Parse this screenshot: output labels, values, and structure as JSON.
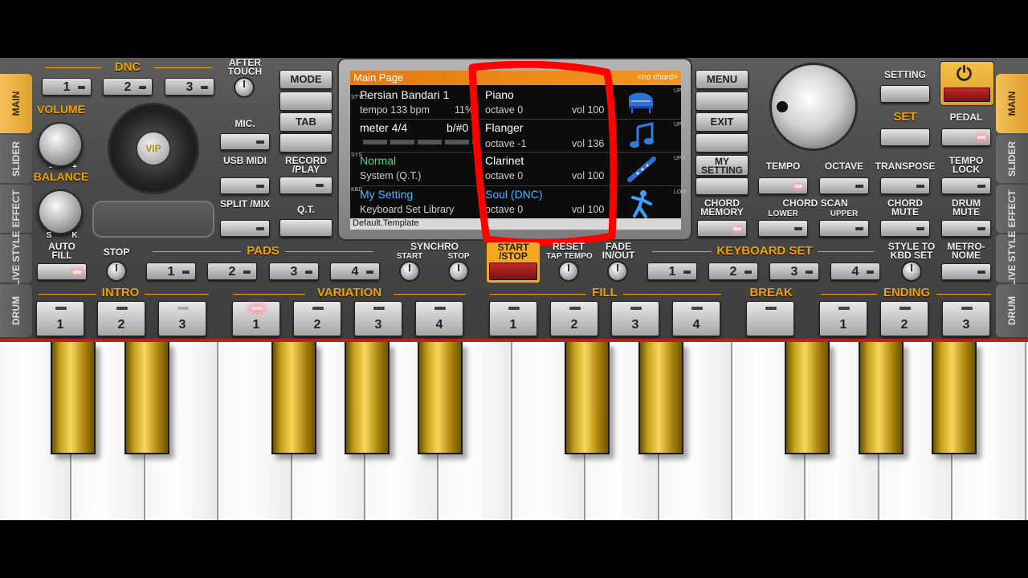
{
  "tabs_left": [
    "MAIN",
    "SLIDER",
    "EFFECT",
    "LIVE STYLE",
    "DRUM"
  ],
  "tabs_right": [
    "MAIN",
    "SLIDER",
    "EFFECT",
    "LIVE STYLE",
    "DRUM"
  ],
  "dnc": {
    "label": "DNC",
    "buttons": [
      "1",
      "2",
      "3"
    ]
  },
  "after_touch": "AFTER TOUCH",
  "volume": "VOLUME",
  "balance": "BALANCE",
  "knob_marks": {
    "minus": "-",
    "plus": "+",
    "s": "S",
    "k": "K"
  },
  "vip_logo": "VIP",
  "mic": "MIC.",
  "usb_midi": "USB MIDI",
  "split_mix": "SPLIT /MIX",
  "mode": "MODE",
  "tab": "TAB",
  "record_play": "RECORD /PLAY",
  "qt": "Q.T.",
  "menu": "MENU",
  "exit": "EXIT",
  "my_setting": "MY SETTING",
  "chord_memory": "CHORD MEMORY",
  "setting": "SETTING",
  "set": "SET",
  "pedal": "PEDAL",
  "tempo": "TEMPO",
  "octave": "OCTAVE",
  "transpose": "TRANSPOSE",
  "tempo_lock": "TEMPO LOCK",
  "chord_scan": "CHORD SCAN",
  "lower": "LOWER",
  "upper": "UPPER",
  "chord_mute": "CHORD MUTE",
  "drum_mute": "DRUM MUTE",
  "auto_fill": "AUTO FILL",
  "stop": "STOP",
  "pads": {
    "label": "PADS",
    "buttons": [
      "1",
      "2",
      "3",
      "4"
    ]
  },
  "synchro": "SYNCHRO",
  "sync_start": "START",
  "sync_stop": "STOP",
  "start_stop": "START /STOP",
  "reset": "RESET",
  "tap_tempo": "TAP TEMPO",
  "fade": "FADE IN/OUT",
  "keyboard_set": {
    "label": "KEYBOARD SET",
    "buttons": [
      "1",
      "2",
      "3",
      "4"
    ]
  },
  "style_to_kbd": "STYLE TO KBD SET",
  "metronome": "METRO- NOME",
  "intro": {
    "label": "INTRO",
    "buttons": [
      "1",
      "2",
      "3"
    ]
  },
  "variation": {
    "label": "VARIATION",
    "buttons": [
      "1",
      "2",
      "3",
      "4"
    ]
  },
  "fill": {
    "label": "FILL",
    "buttons": [
      "1",
      "2",
      "3",
      "4"
    ]
  },
  "break": "BREAK",
  "ending": {
    "label": "ENDING",
    "buttons": [
      "1",
      "2",
      "3"
    ]
  },
  "screen": {
    "title": "Main Page",
    "chord": "<no chord>",
    "style_name": "Persian Bandari 1",
    "tempo": "tempo 133 bpm",
    "tempo_pct": "11%",
    "meter": "meter 4/4",
    "beat": "b/#0",
    "sys_mode": "Normal",
    "sys_sub": "System (Q.T.)",
    "kbd_name": "My Setting",
    "kbd_sub": "Keyboard Set Library",
    "template": "Default.Template",
    "side_style": "STYLE",
    "side_sys": "SYS",
    "side_kbd": "KBD",
    "side_up1": "UP1",
    "side_up2": "UP2",
    "side_up3": "UP3",
    "side_low": "LOW",
    "parts": [
      {
        "name": "Piano",
        "octave": "octave 0",
        "vol": "vol 100",
        "icon": "grand-piano-icon"
      },
      {
        "name": "Flanger",
        "octave": "octave -1",
        "vol": "vol 136",
        "icon": "music-note-icon"
      },
      {
        "name": "Clarinet",
        "octave": "octave 0",
        "vol": "vol 100",
        "icon": "clarinet-icon"
      },
      {
        "name": "Soul (DNC)",
        "octave": "octave 0",
        "vol": "vol 100",
        "icon": "dancer-icon"
      }
    ]
  },
  "colors": {
    "accent": "#f1a400",
    "highlight": "#ff0000",
    "lcd_header": "#f3951f",
    "sys_text": "#53d17a",
    "kbd_text": "#4fb4ff"
  }
}
